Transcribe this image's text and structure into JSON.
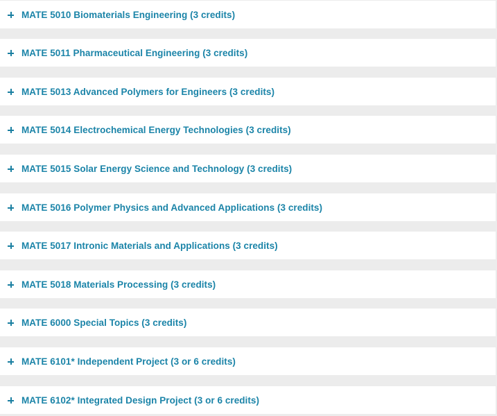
{
  "accent_color": "#1b84a8",
  "courses": [
    {
      "icon": "plus-icon",
      "label": "MATE 5010 Biomaterials Engineering (3 credits)"
    },
    {
      "icon": "plus-icon",
      "label": "MATE 5011 Pharmaceutical Engineering (3 credits)"
    },
    {
      "icon": "plus-icon",
      "label": "MATE 5013 Advanced Polymers for Engineers (3 credits)"
    },
    {
      "icon": "plus-icon",
      "label": "MATE 5014 Electrochemical Energy Technologies (3 credits)"
    },
    {
      "icon": "plus-icon",
      "label": "MATE 5015 Solar Energy Science and Technology (3 credits)"
    },
    {
      "icon": "plus-icon",
      "label": "MATE 5016 Polymer Physics and Advanced Applications (3 credits)"
    },
    {
      "icon": "plus-icon",
      "label": "MATE 5017 Intronic Materials and Applications (3 credits)"
    },
    {
      "icon": "plus-icon",
      "label": "MATE 5018 Materials Processing (3 credits)"
    },
    {
      "icon": "plus-icon",
      "label": "MATE 6000 Special Topics (3 credits)"
    },
    {
      "icon": "plus-icon",
      "label": "MATE 6101* Independent Project (3 or 6 credits)"
    },
    {
      "icon": "plus-icon",
      "label": "MATE 6102* Integrated Design Project (3 or 6 credits)"
    }
  ]
}
